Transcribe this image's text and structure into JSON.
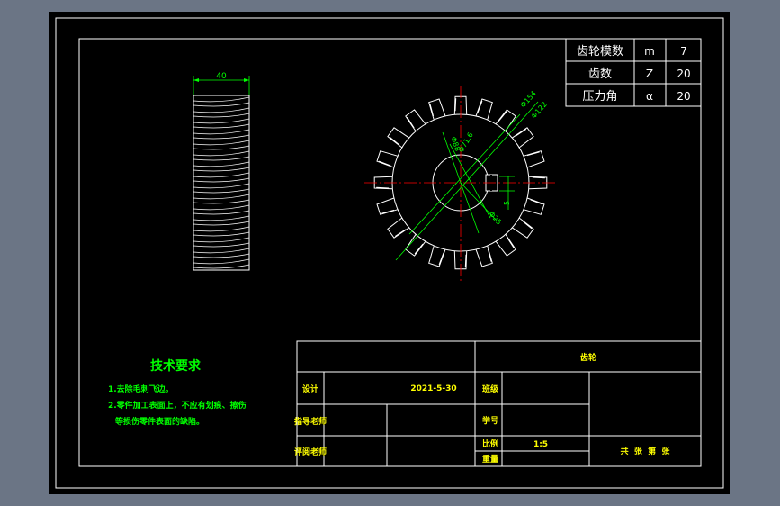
{
  "params_table": {
    "rows": [
      {
        "name": "齿轮模数",
        "symbol": "m",
        "value": "7"
      },
      {
        "name": "齿数",
        "symbol": "Z",
        "value": "20"
      },
      {
        "name": "压力角",
        "symbol": "α",
        "value": "20"
      }
    ]
  },
  "side_view": {
    "width_dim": "40"
  },
  "front_view": {
    "dims": [
      "Φ154",
      "Φ122",
      "Φ88",
      "Φ71.6",
      "Φ25",
      "5"
    ]
  },
  "tech_requirements": {
    "title": "技术要求",
    "items": [
      "1.去除毛刺飞边。",
      "2.零件加工表面上，不应有划痕、擦伤",
      "等损伤零件表面的缺陷。"
    ]
  },
  "title_block": {
    "part_name": "齿轮",
    "design_label": "设计",
    "design_date": "2021-5-30",
    "class_label": "班级",
    "instructor_label": "指导老师",
    "student_no_label": "学号",
    "reviewer_label": "评阅老师",
    "scale_label": "比例",
    "scale_value": "1:5",
    "weight_label": "重量",
    "sheets_text": "共  张  第  张"
  },
  "colors": {
    "background": "#000000",
    "frame": "#ffffff",
    "dimension": "#00ff00",
    "centerline": "#ff0000",
    "annotation": "#ffff00"
  }
}
